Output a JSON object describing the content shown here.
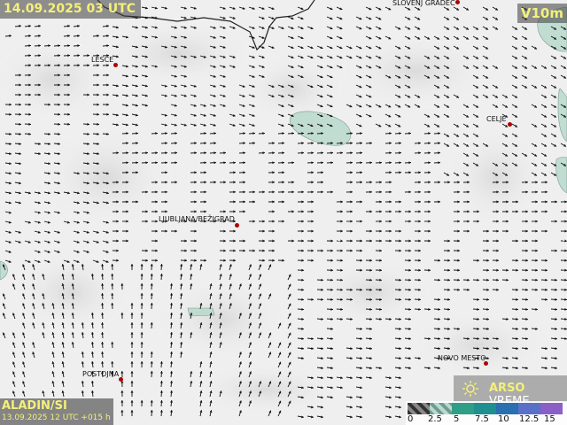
{
  "header": {
    "valid_time": "14.09.2025 03 UTC",
    "variable": "V10m"
  },
  "model": {
    "name": "ALADIN/SI",
    "run": "13.09.2025 12 UTC +015 h"
  },
  "logo": {
    "brand": "ARSO",
    "suffix": "VREME"
  },
  "cities": [
    {
      "name": "SLOVENJ GRADEC"
    },
    {
      "name": "LESCE"
    },
    {
      "name": "CELJE"
    },
    {
      "name": "LJUBLJANA/BEŽIGRAD"
    },
    {
      "name": "NOVO MESTO"
    },
    {
      "name": "POSTOJNA"
    }
  ],
  "scale": {
    "ticks": [
      "0",
      "2.5",
      "5",
      "7.5",
      "10",
      "12.5",
      "15"
    ],
    "colors": [
      "#4a4a4a",
      "#8fb8ae",
      "#2f9e86",
      "#1f8f8f",
      "#2a6fb0",
      "#5a6fc8",
      "#8a5fc8"
    ]
  },
  "colors": {
    "title_text": "#f4f07a",
    "city_dot": "#b00000",
    "wind_patch": "#b9d9cc"
  }
}
